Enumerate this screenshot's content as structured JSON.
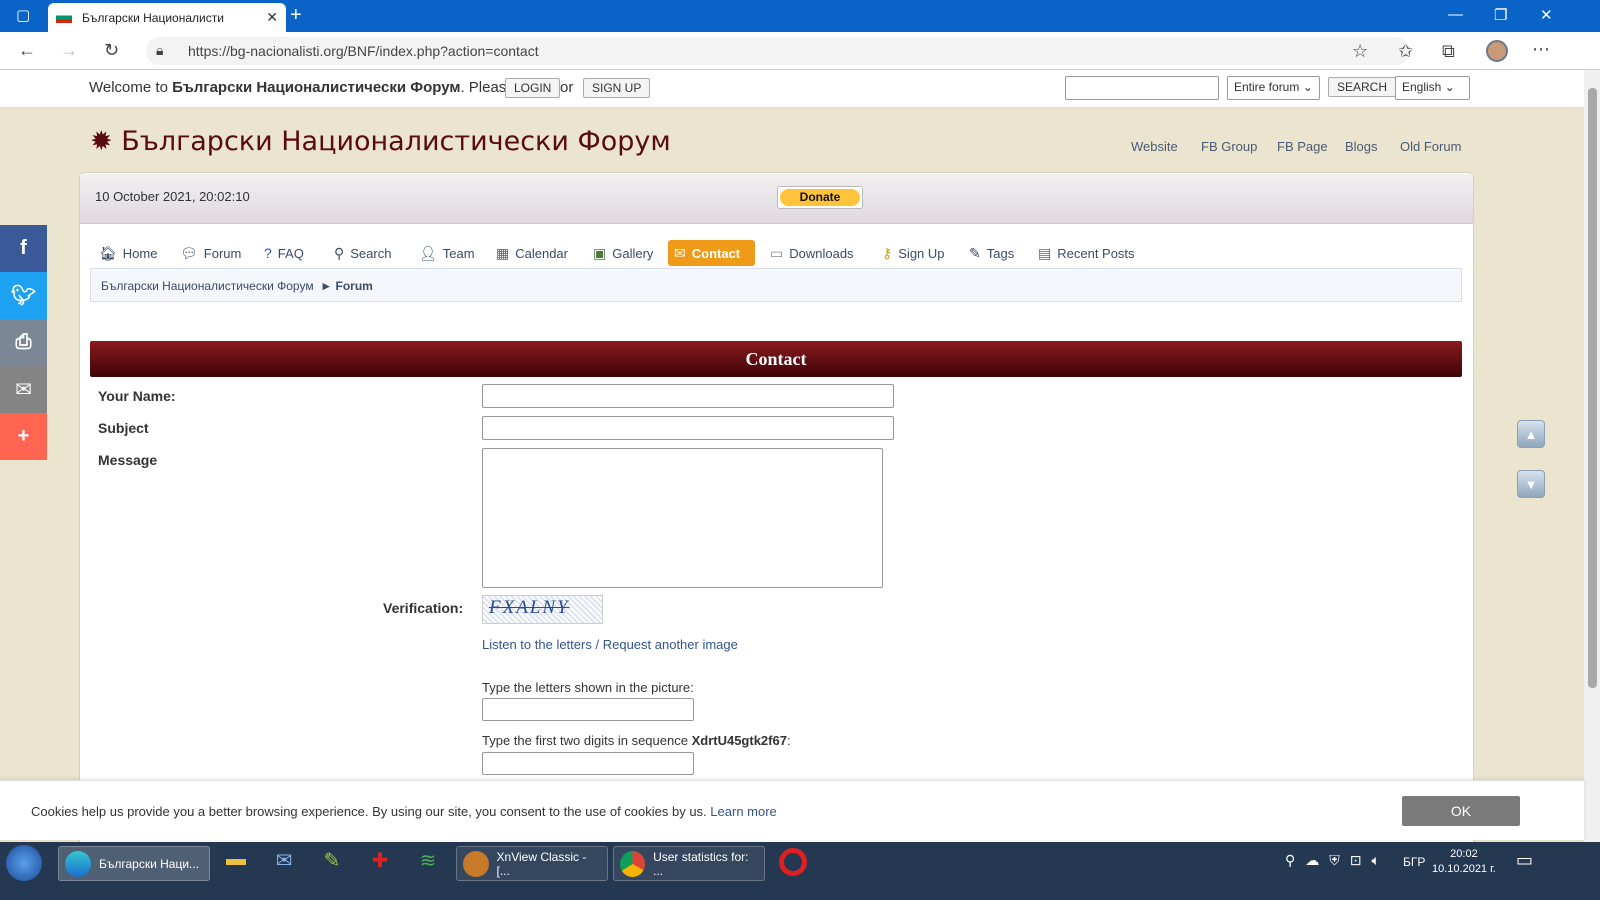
{
  "browser": {
    "tab_title": "Български Националисти",
    "tab_close": "✕",
    "new_tab": "+",
    "url": "https://bg-nacionalisti.org/BNF/index.php?action=contact"
  },
  "topbar": {
    "welcome_prefix": "Welcome to",
    "forum_name": "Български Националистически Форум",
    "welcome_suffix": ". Please",
    "login_label": "LOGIN",
    "or": "or",
    "signup_label": "SIGN UP",
    "search_scope": "Entire forum",
    "search_button": "SEARCH",
    "language": "English"
  },
  "header": {
    "logo_text": "Български Националистически Форум",
    "links": [
      "Website",
      "FB Group",
      "FB Page",
      "Blogs",
      "Old Forum"
    ]
  },
  "datebar": {
    "date": "10 October 2021, 20:02:10",
    "donate": "Donate"
  },
  "nav": [
    {
      "label": "Home",
      "icon": "home-icon"
    },
    {
      "label": "Forum",
      "icon": "forum-icon"
    },
    {
      "label": "FAQ",
      "icon": "help-icon"
    },
    {
      "label": "Search",
      "icon": "search-icon"
    },
    {
      "label": "Team",
      "icon": "team-icon"
    },
    {
      "label": "Calendar",
      "icon": "calendar-icon"
    },
    {
      "label": "Gallery",
      "icon": "gallery-icon"
    },
    {
      "label": "Contact",
      "icon": "mail-icon",
      "active": true
    },
    {
      "label": "Downloads",
      "icon": "downloads-icon"
    },
    {
      "label": "Sign Up",
      "icon": "key-icon"
    },
    {
      "label": "Tags",
      "icon": "tags-icon"
    },
    {
      "label": "Recent Posts",
      "icon": "document-icon"
    }
  ],
  "breadcrumb": {
    "root": "Български Националистически Форум",
    "sep": "►",
    "current": "Forum"
  },
  "form": {
    "title": "Contact",
    "name_label": "Your Name:",
    "subject_label": "Subject",
    "message_label": "Message",
    "verification_label": "Verification:",
    "captcha_text": "FXALNY",
    "listen_link": "Listen to the letters",
    "link_sep": "/",
    "request_link": "Request another image",
    "type_letters_label": "Type the letters shown in the picture:",
    "digits_prefix": "Type the first two digits in sequence",
    "digits_sequence": "XdrtU45gtk2f67",
    "digits_suffix": ":"
  },
  "cookie": {
    "text": "Cookies help us provide you a better browsing experience. By using our site, you consent to the use of cookies by us.",
    "learn_more": "Learn more",
    "ok": "OK"
  },
  "social": [
    "f",
    "t",
    "print",
    "mail",
    "+"
  ],
  "taskbar": {
    "items": [
      "Български Наци...",
      "XnView Classic - [...",
      "User statistics for: ..."
    ],
    "lang": "БГР",
    "time": "20:02",
    "date": "10.10.2021 г."
  },
  "colors": {
    "titlebar": "#0a64c8",
    "page_bg": "#ebe5cf",
    "accent_orange": "#f09a1a",
    "header_maroon": "#5a0b0f"
  }
}
